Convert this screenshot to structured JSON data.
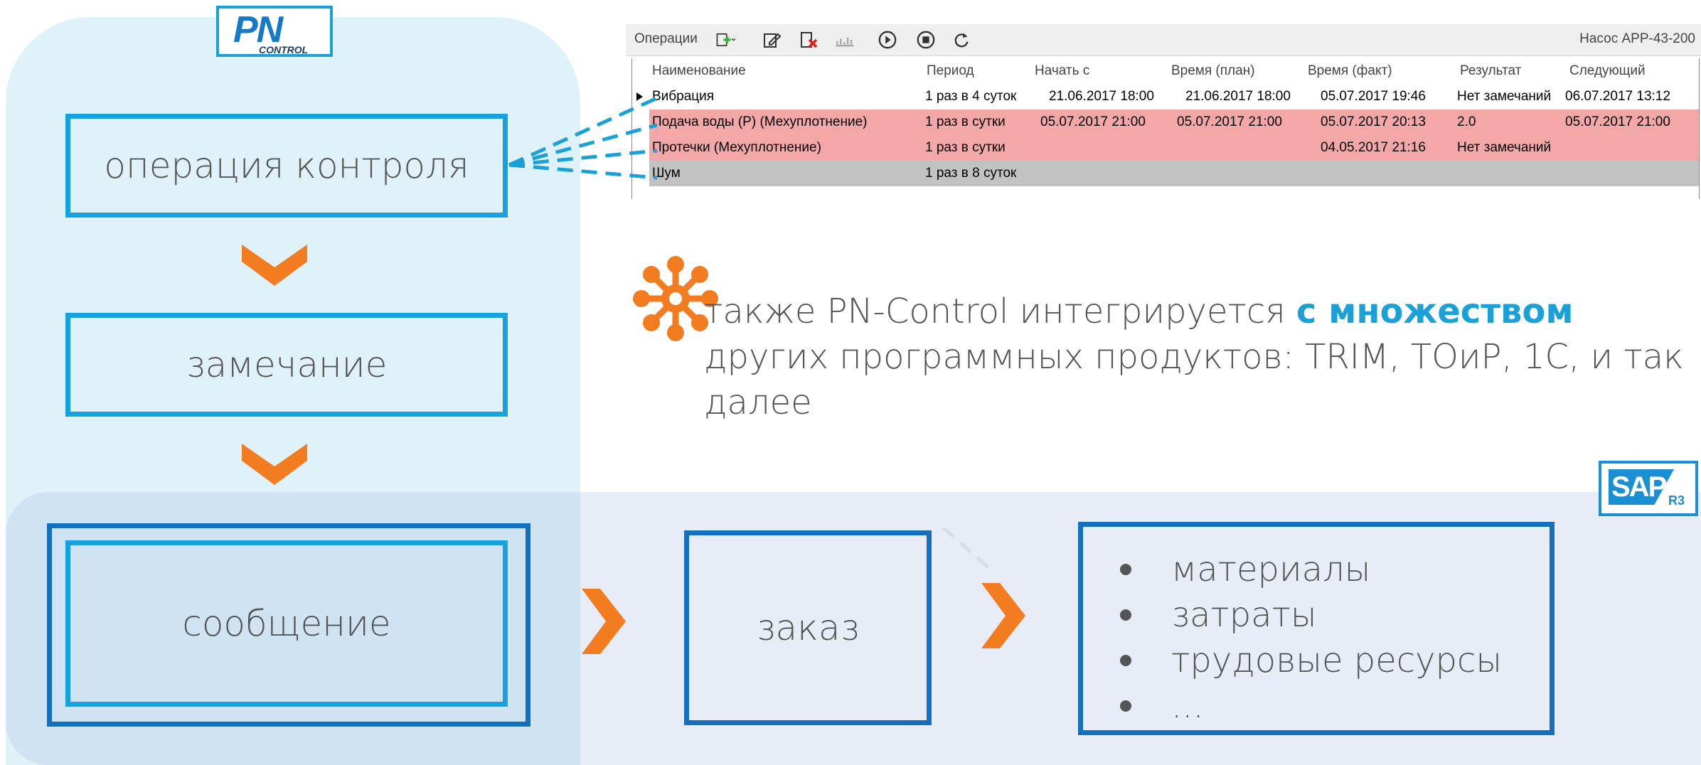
{
  "colors": {
    "accent": "#1ba0d8",
    "dark_blue": "#1370bf",
    "orange": "#f47c20",
    "pink_row": "#f4a7a7",
    "gray_row": "#c2c2c2"
  },
  "logo": {
    "pn_text": "PN",
    "control_text": "CONTROL"
  },
  "flow": {
    "operation": "операция контроля",
    "remark": "замечание",
    "message": "сообщение",
    "order": "заказ",
    "list": [
      "материалы",
      "затраты",
      "трудовые ресурсы",
      "..."
    ]
  },
  "sap_logo": {
    "text": "SAP",
    "version": "R3"
  },
  "toolbar": {
    "title": "Операции",
    "right_label": "Насос APP-43-200",
    "icons": [
      "add-icon",
      "edit-icon",
      "delete-icon",
      "chart-icon",
      "play-icon",
      "stop-icon",
      "refresh-icon"
    ]
  },
  "table": {
    "columns": [
      "Наименование",
      "Период",
      "Начать с",
      "Время (план)",
      "Время (факт)",
      "Результат",
      "Следующий"
    ],
    "rows": [
      [
        "Вибрация",
        "1 раз в 4 суток",
        "21.06.2017 18:00",
        "21.06.2017 18:00",
        "05.07.2017 19:46",
        "Нет замечаний",
        "06.07.2017 13:12"
      ],
      [
        "Подача воды (Р) (Мехуплотнение)",
        "1 раз в сутки",
        "05.07.2017 21:00",
        "05.07.2017 21:00",
        "05.07.2017 20:13",
        "2.0",
        "05.07.2017 21:00"
      ],
      [
        "Протечки (Мехуплотнение)",
        "1 раз в сутки",
        "",
        "",
        "04.05.2017 21:16",
        "Нет замечаний",
        ""
      ],
      [
        "Шум",
        "1 раз в 8 суток",
        "",
        "",
        "",
        "",
        ""
      ]
    ]
  },
  "integration": {
    "part1": "также PN-Control интегрируется ",
    "highlight": "с множеством",
    "part2": "других программных продуктов: TRIM, ТОиР, 1С, и так далее"
  }
}
